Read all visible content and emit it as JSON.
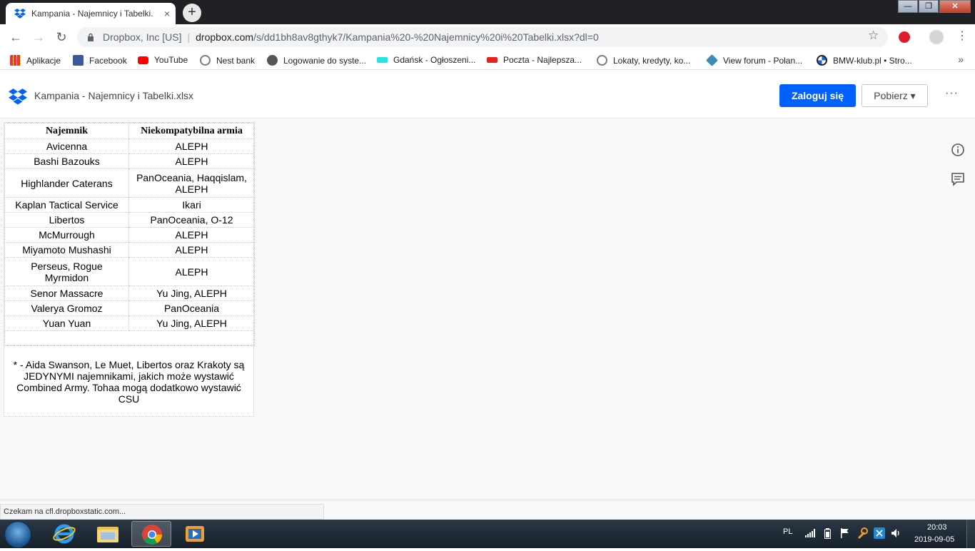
{
  "browser": {
    "tab_title": "Kampania - Najemnicy i Tabelki.xlsx",
    "tab_close": "×",
    "new_tab": "+",
    "site_identity": "Dropbox, Inc [US]",
    "url_host": "dropbox.com",
    "url_path": "/s/dd1bh8av8gthyk7/Kampania%20-%20Najemnicy%20i%20Tabelki.xlsx?dl=0",
    "window_min": "—",
    "window_max": "❐",
    "window_close": "✕"
  },
  "bookmarks": [
    {
      "label": "Aplikacje",
      "icon": "apps-grid-icon",
      "color": "#e53935"
    },
    {
      "label": "Facebook",
      "icon": "facebook-icon",
      "color": "#3b5998"
    },
    {
      "label": "YouTube",
      "icon": "youtube-icon",
      "color": "#ff0000"
    },
    {
      "label": "Nest bank",
      "icon": "nest-bank-icon",
      "color": "#7b7b7b"
    },
    {
      "label": "Logowanie do syste...",
      "icon": "globe-icon",
      "color": "#555555"
    },
    {
      "label": "Gdańsk - Ogłoszeni...",
      "icon": "olx-icon",
      "color": "#23e5db"
    },
    {
      "label": "Poczta - Najlepsza...",
      "icon": "wp-icon",
      "color": "#e2231a"
    },
    {
      "label": "Lokaty, kredyty, ko...",
      "icon": "nest-bank-icon",
      "color": "#7b7b7b"
    },
    {
      "label": "View forum - Polan...",
      "icon": "forum-icon",
      "color": "#3a8fb7"
    },
    {
      "label": "BMW-klub.pl • Stro...",
      "icon": "bmw-icon",
      "color": "#1c69d4"
    }
  ],
  "dropbox": {
    "file_name": "Kampania - Najemnicy i Tabelki.xlsx",
    "login_label": "Zaloguj się",
    "download_label": "Pobierz ▾",
    "more_label": "···"
  },
  "sheet": {
    "headers": [
      "Najemnik",
      "Niekompatybilna armia"
    ],
    "rows": [
      [
        "Avicenna",
        "ALEPH"
      ],
      [
        "Bashi Bazouks",
        "ALEPH"
      ],
      [
        "Highlander Caterans",
        "PanOceania, Haqqislam, ALEPH"
      ],
      [
        "Kaplan Tactical Service",
        "Ikari"
      ],
      [
        "Libertos",
        "PanOceania, O-12"
      ],
      [
        "McMurrough",
        "ALEPH"
      ],
      [
        "Miyamoto Mushashi",
        "ALEPH"
      ],
      [
        "Perseus, Rogue Myrmidon",
        "ALEPH"
      ],
      [
        "Senor Massacre",
        "Yu Jing, ALEPH"
      ],
      [
        "Valerya Gromoz",
        "PanOceania"
      ],
      [
        "Yuan Yuan",
        "Yu Jing, ALEPH"
      ]
    ],
    "note": "* - Aida Swanson, Le Muet, Libertos oraz Krakoty są JEDYNYMI najemnikami, jakich może wystawić Combined Army. Tohaa mogą dodatkowo wystawić CSU"
  },
  "status": {
    "loading_text": "Czekam na cfl.dropboxstatic.com..."
  },
  "taskbar": {
    "language": "PL",
    "time": "20:03",
    "date": "2019-09-05"
  },
  "colors": {
    "dropbox_blue": "#0061fe",
    "chrome_dark": "#202124"
  }
}
